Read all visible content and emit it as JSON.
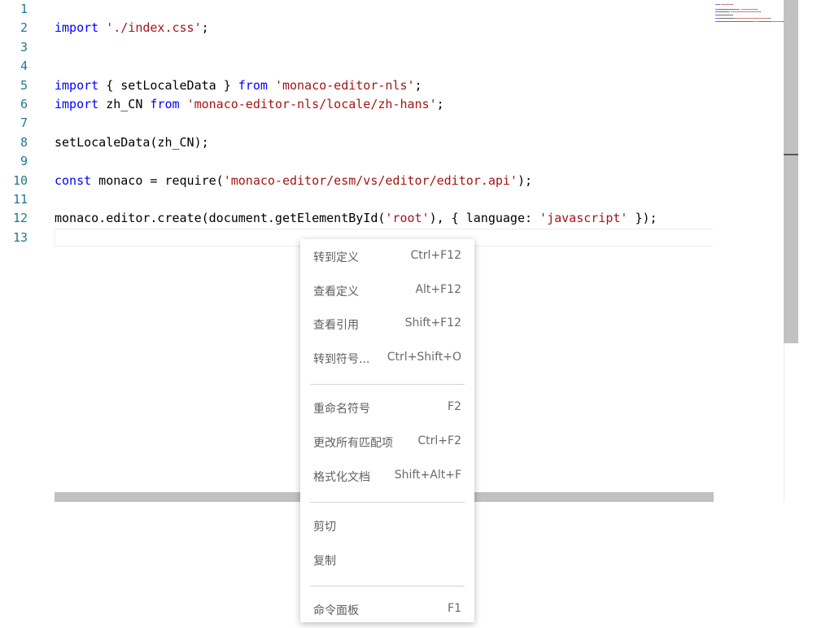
{
  "colors": {
    "line_number": "#237893",
    "keyword": "#0000ff",
    "string": "#a31515",
    "text": "#000000",
    "scrollbar": "#c1c1c1"
  },
  "editor": {
    "line_numbers": [
      "1",
      "2",
      "3",
      "4",
      "5",
      "6",
      "7",
      "8",
      "9",
      "10",
      "11",
      "12",
      "13"
    ],
    "lines": [
      [],
      [
        {
          "t": "import",
          "k": "keyword"
        },
        {
          "t": " ",
          "k": "text"
        },
        {
          "t": "'./index.css'",
          "k": "string"
        },
        {
          "t": ";",
          "k": "text"
        }
      ],
      [],
      [],
      [
        {
          "t": "import",
          "k": "keyword"
        },
        {
          "t": " { setLocaleData } ",
          "k": "text"
        },
        {
          "t": "from",
          "k": "keyword"
        },
        {
          "t": " ",
          "k": "text"
        },
        {
          "t": "'monaco-editor-nls'",
          "k": "string"
        },
        {
          "t": ";",
          "k": "text"
        }
      ],
      [
        {
          "t": "import",
          "k": "keyword"
        },
        {
          "t": " zh_CN ",
          "k": "text"
        },
        {
          "t": "from",
          "k": "keyword"
        },
        {
          "t": " ",
          "k": "text"
        },
        {
          "t": "'monaco-editor-nls/locale/zh-hans'",
          "k": "string"
        },
        {
          "t": ";",
          "k": "text"
        }
      ],
      [],
      [
        {
          "t": "setLocaleData(zh_CN);",
          "k": "text"
        }
      ],
      [],
      [
        {
          "t": "const",
          "k": "keyword"
        },
        {
          "t": " monaco = require(",
          "k": "text"
        },
        {
          "t": "'monaco-editor/esm/vs/editor/editor.api'",
          "k": "string"
        },
        {
          "t": ");",
          "k": "text"
        }
      ],
      [],
      [
        {
          "t": "monaco.editor.create(document.getElementById(",
          "k": "text"
        },
        {
          "t": "'root'",
          "k": "string"
        },
        {
          "t": "), { language: ",
          "k": "text"
        },
        {
          "t": "'javascript'",
          "k": "string"
        },
        {
          "t": " });",
          "k": "text"
        }
      ],
      []
    ]
  },
  "context_menu": {
    "groups": [
      [
        {
          "label": "转到定义",
          "shortcut": "Ctrl+F12"
        },
        {
          "label": "查看定义",
          "shortcut": "Alt+F12"
        },
        {
          "label": "查看引用",
          "shortcut": "Shift+F12"
        },
        {
          "label": "转到符号...",
          "shortcut": "Ctrl+Shift+O"
        }
      ],
      [
        {
          "label": "重命名符号",
          "shortcut": "F2"
        },
        {
          "label": "更改所有匹配项",
          "shortcut": "Ctrl+F2"
        },
        {
          "label": "格式化文档",
          "shortcut": "Shift+Alt+F"
        }
      ],
      [
        {
          "label": "剪切",
          "shortcut": ""
        },
        {
          "label": "复制",
          "shortcut": ""
        }
      ],
      [
        {
          "label": "命令面板",
          "shortcut": "F1"
        }
      ]
    ]
  }
}
